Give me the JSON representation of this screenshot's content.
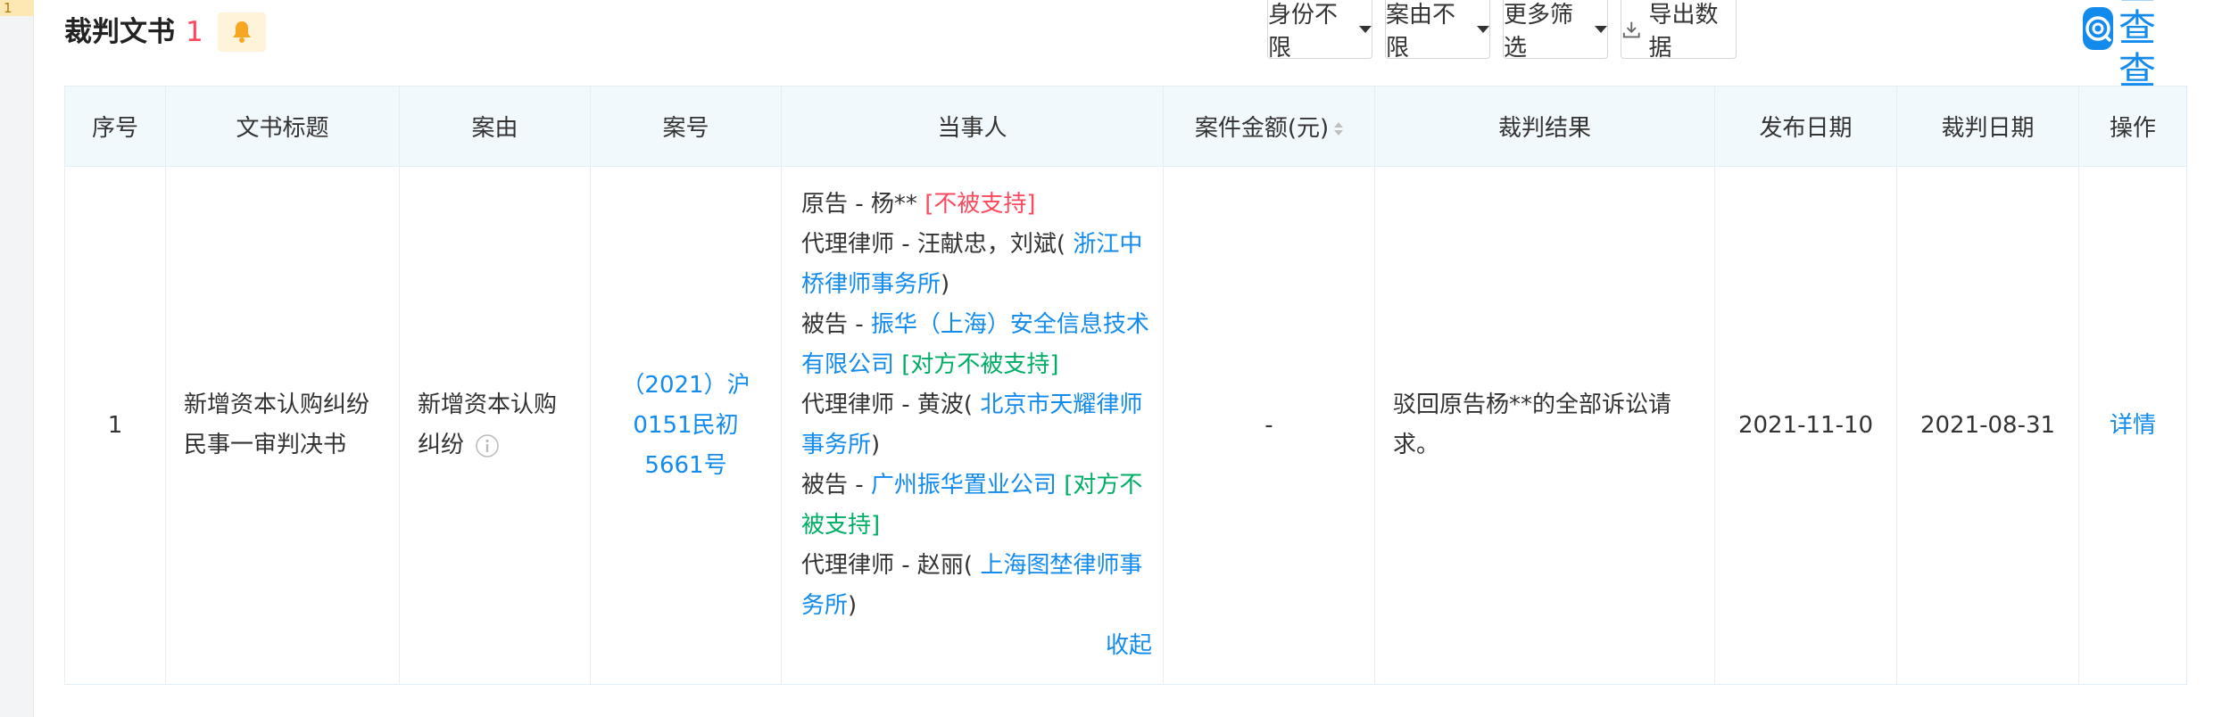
{
  "corner_tag": "1",
  "section": {
    "title": "裁判文书",
    "count": "1"
  },
  "toolbar": {
    "identity_label": "身份不限",
    "cause_label": "案由不限",
    "more_label": "更多筛选",
    "export_label": "导出数据"
  },
  "brand": {
    "name": "企查查",
    "color": "#128bed"
  },
  "colors": {
    "link": "#128bed",
    "negative": "#fd485e",
    "positive": "#00ad65",
    "header_bg": "#f2f9fc"
  },
  "table": {
    "headers": [
      "序号",
      "文书标题",
      "案由",
      "案号",
      "当事人",
      "案件金额(元)",
      "裁判结果",
      "发布日期",
      "裁判日期",
      "操作"
    ],
    "rows": [
      {
        "index": "1",
        "doc_title": "新增资本认购纠纷民事一审判决书",
        "cause": "新增资本认购纠纷",
        "case_no": "（2021）沪0151民初5661号",
        "parties": {
          "p1_role": "原告 - ",
          "p1_name": "杨**",
          "p1_status": "[不被支持]",
          "p1_lawyer_role": "代理律师 - ",
          "p1_lawyer_names": "汪献忠，刘斌(",
          "p1_lawyer_firm": "浙江中桥律师事务所",
          "p2_role": "被告 - ",
          "p2_name": "振华（上海）安全信息技术有限公司",
          "p2_status": "[对方不被支持]",
          "p2_lawyer_role": "代理律师 - ",
          "p2_lawyer_names": "黄波(",
          "p2_lawyer_firm": "北京市天耀律师事务所",
          "p3_role": "被告 - ",
          "p3_name": "广州振华置业公司",
          "p3_status": "[对方不被支持]",
          "p3_lawyer_role": "代理律师 - ",
          "p3_lawyer_names": "赵丽(",
          "p3_lawyer_firm": "上海图埜律师事务所",
          "close_paren": ")",
          "collapse_label": "收起"
        },
        "amount": "-",
        "result": "驳回原告杨**的全部诉讼请求。",
        "publish_date": "2021-11-10",
        "judgment_date": "2021-08-31",
        "action": "详情"
      }
    ]
  }
}
